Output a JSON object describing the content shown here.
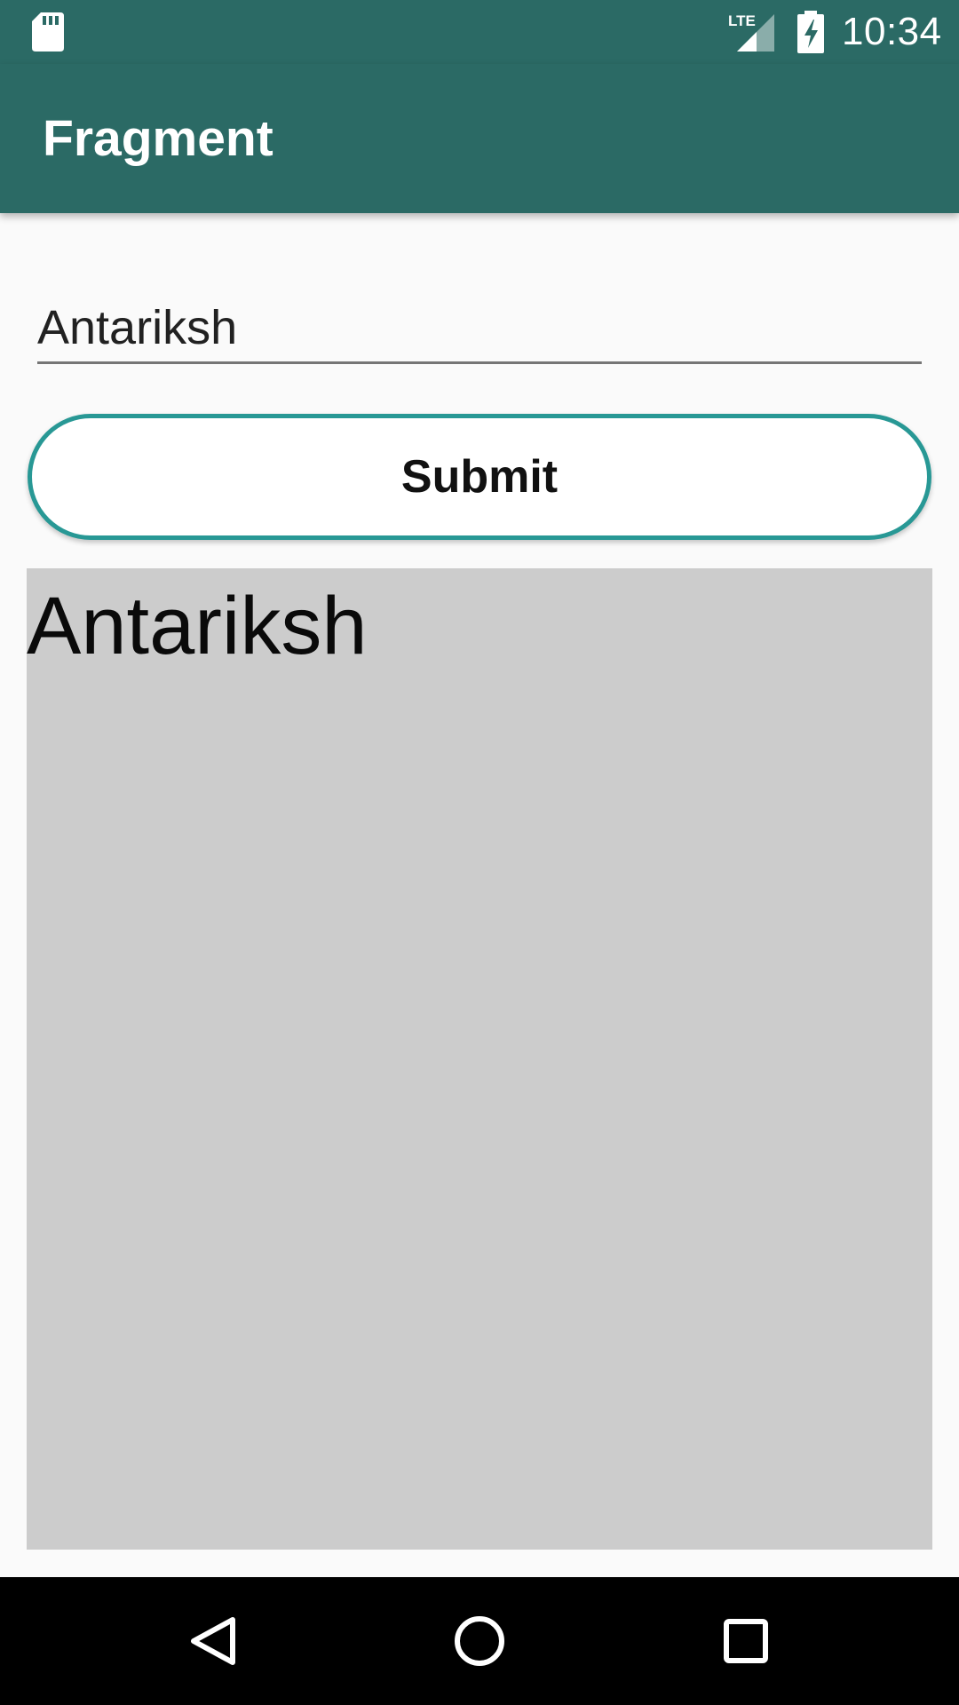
{
  "status_bar": {
    "time": "10:34",
    "network_label": "LTE",
    "icons": [
      "sd-card-icon",
      "lte-signal-icon",
      "battery-charging-icon"
    ],
    "background_color": "#2b6a65"
  },
  "app_bar": {
    "title": "Fragment",
    "background_color": "#2b6a65"
  },
  "form": {
    "name_field_value": "Antariksh",
    "submit_label": "Submit",
    "accent_color": "#289895"
  },
  "display": {
    "text": "Antariksh",
    "background_color": "#cccccc"
  },
  "nav_bar": {
    "icons": [
      "back-icon",
      "home-icon",
      "recents-icon"
    ]
  }
}
